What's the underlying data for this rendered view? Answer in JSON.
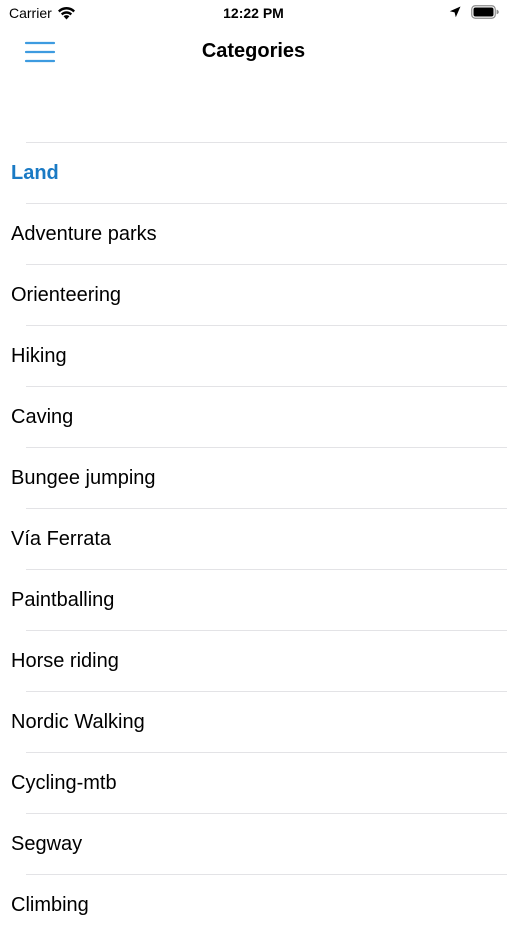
{
  "status_bar": {
    "carrier": "Carrier",
    "time": "12:22 PM",
    "icons": [
      "wifi-icon",
      "location-arrow-icon",
      "battery-icon"
    ]
  },
  "nav": {
    "title": "Categories",
    "menu_icon": "hamburger-menu-icon",
    "accent_color": "#3d9be0"
  },
  "list": {
    "section_header": "Land",
    "header_color": "#1a7ac4",
    "items": [
      "Adventure parks",
      "Orienteering",
      "Hiking",
      "Caving",
      "Bungee jumping",
      "Vía Ferrata",
      "Paintballing",
      "Horse riding",
      "Nordic Walking",
      "Cycling-mtb",
      "Segway",
      "Climbing"
    ]
  }
}
